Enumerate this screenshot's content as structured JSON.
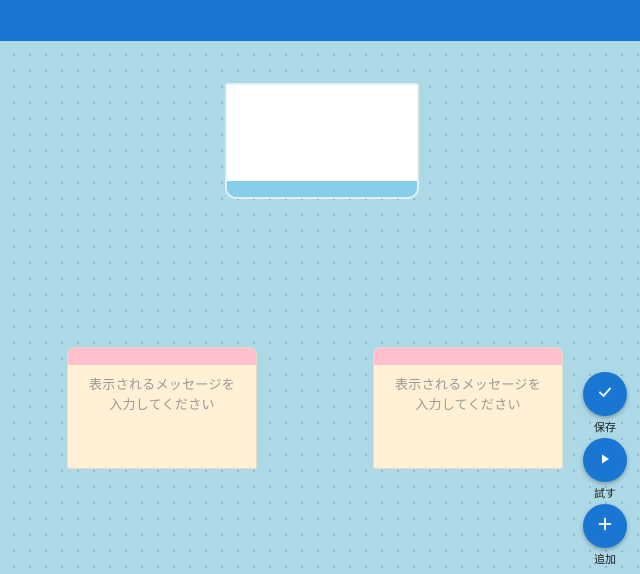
{
  "app_bar": {
    "color": "#1976d2"
  },
  "canvas": {
    "background": "#add8e6"
  },
  "image_card": {
    "footer_color": "#87ceeb"
  },
  "message_cards": [
    {
      "header_color": "#ffc0cb",
      "placeholder_line1": "表示されるメッセージを",
      "placeholder_line2": "入力してください"
    },
    {
      "header_color": "#ffc0cb",
      "placeholder_line1": "表示されるメッセージを",
      "placeholder_line2": "入力してください"
    }
  ],
  "fabs": {
    "save": {
      "icon": "check-icon",
      "label": "保存"
    },
    "try": {
      "icon": "play-icon",
      "label": "試す"
    },
    "add": {
      "icon": "plus-icon",
      "label": "追加"
    }
  }
}
